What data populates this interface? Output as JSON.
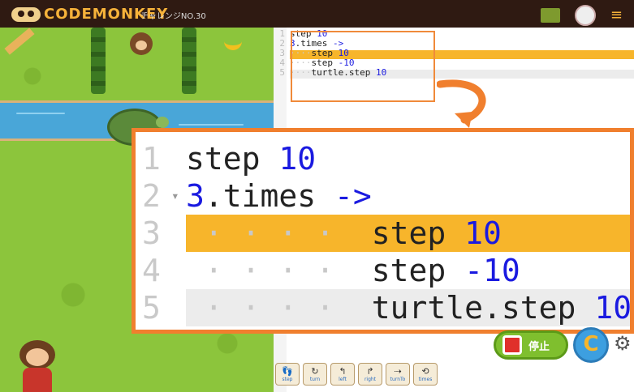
{
  "header": {
    "logo_text": "CODEMONKEY",
    "challenge_label": "チャレンジNO.30",
    "icons": [
      "map-icon",
      "avatar-icon",
      "menu-icon"
    ],
    "menu_glyph": "≡"
  },
  "editor": {
    "lines": [
      {
        "num": "1",
        "parts": [
          {
            "text": "step ",
            "cls": "kw"
          },
          {
            "text": "10",
            "cls": "num"
          }
        ],
        "indent": ""
      },
      {
        "num": "2",
        "parts": [
          {
            "text": "3",
            "cls": "num"
          },
          {
            "text": ".times ",
            "cls": "kw"
          },
          {
            "text": "->",
            "cls": "arrow"
          }
        ],
        "indent": ""
      },
      {
        "num": "3",
        "parts": [
          {
            "text": "step ",
            "cls": "kw"
          },
          {
            "text": "10",
            "cls": "num"
          }
        ],
        "indent": "····"
      },
      {
        "num": "4",
        "parts": [
          {
            "text": "step ",
            "cls": "kw"
          },
          {
            "text": "-10",
            "cls": "num"
          }
        ],
        "indent": "····"
      },
      {
        "num": "5",
        "parts": [
          {
            "text": "turtle.step ",
            "cls": "kw"
          },
          {
            "text": "10",
            "cls": "num"
          }
        ],
        "indent": "····"
      }
    ],
    "highlighted_line": 3,
    "cursor_line": 5
  },
  "controls": {
    "stop_label": "停止",
    "reset_glyph": "C",
    "settings_glyph": "⚙"
  },
  "palette": [
    {
      "label": "step",
      "icon": "footsteps-icon",
      "glyph": "👣"
    },
    {
      "label": "turn",
      "icon": "turn-icon",
      "glyph": "↻"
    },
    {
      "label": "left",
      "icon": "left-arrow-icon",
      "glyph": "↰"
    },
    {
      "label": "right",
      "icon": "right-arrow-icon",
      "glyph": "↱"
    },
    {
      "label": "turnTo",
      "icon": "turnto-icon",
      "glyph": "⇢"
    },
    {
      "label": "times",
      "icon": "loop-icon",
      "glyph": "⟲"
    }
  ],
  "colors": {
    "accent_orange": "#f07f2e",
    "highlight_line": "#f7b52b",
    "number_blue": "#1a1ae0",
    "grass": "#8cc53c",
    "river": "#49a6d8"
  }
}
